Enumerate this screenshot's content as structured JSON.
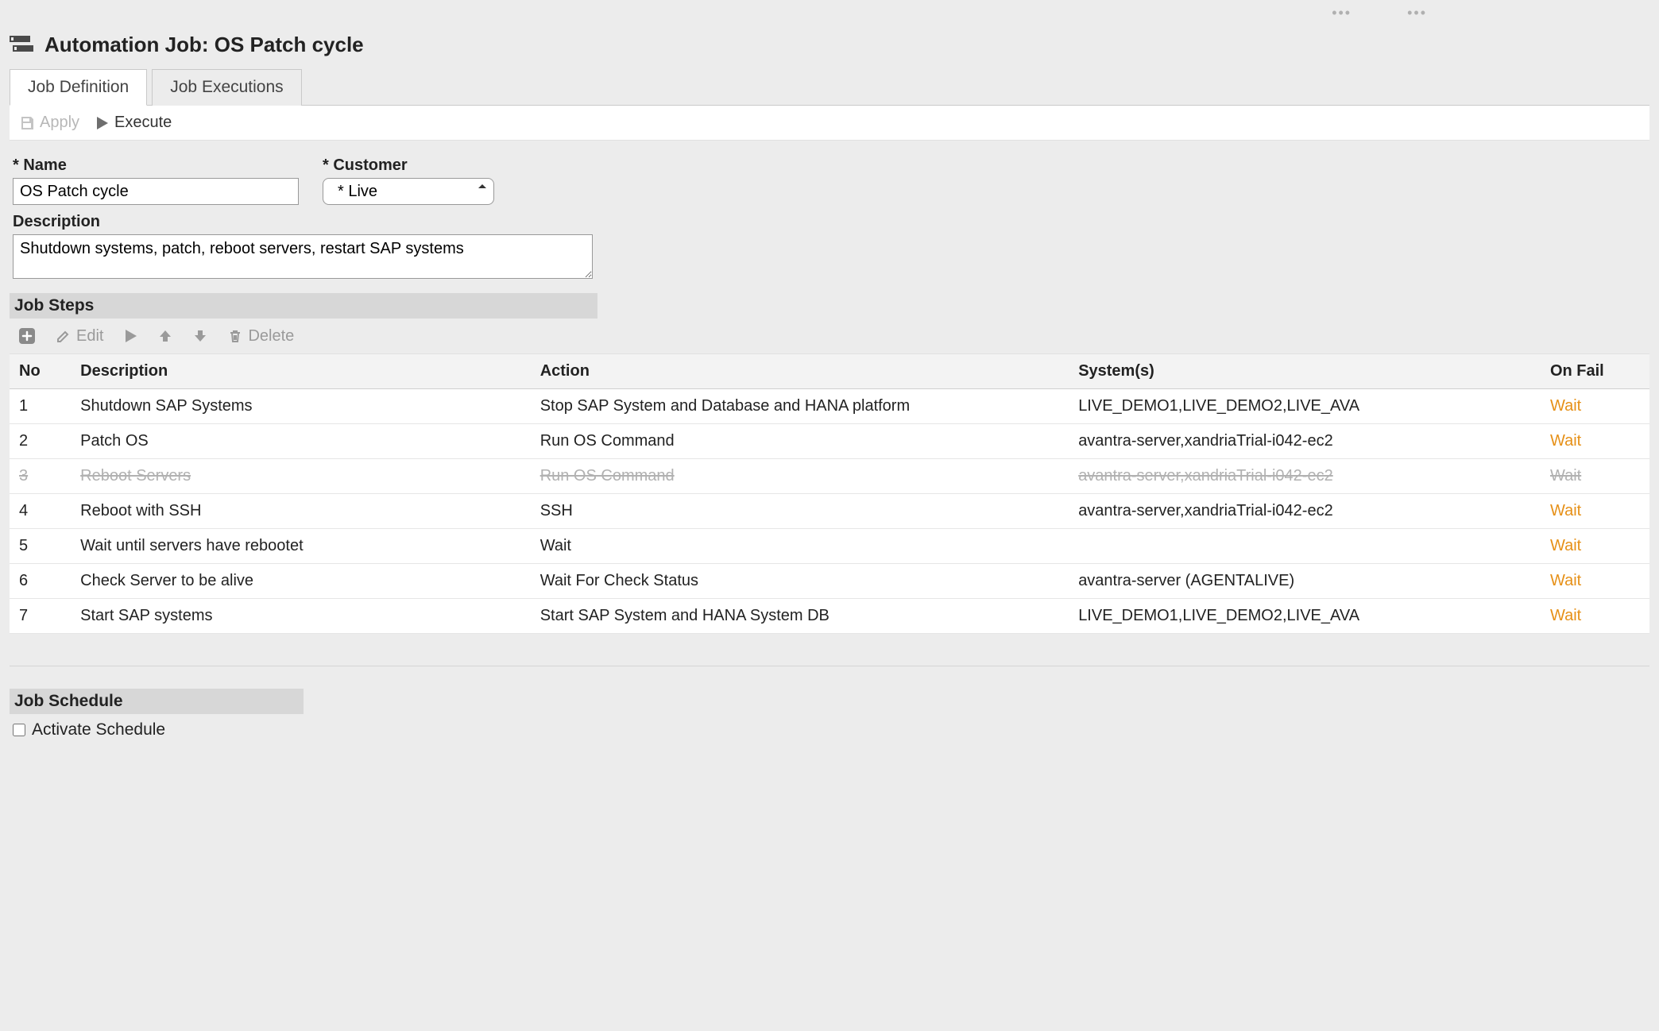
{
  "header": {
    "title": "Automation Job: OS Patch cycle"
  },
  "tabs": {
    "definition": "Job Definition",
    "executions": "Job Executions"
  },
  "toolbar": {
    "apply": "Apply",
    "execute": "Execute"
  },
  "form": {
    "name_label": "* Name",
    "name_value": "OS Patch cycle",
    "customer_label": "* Customer",
    "customer_value": "* Live",
    "description_label": "Description",
    "description_value": "Shutdown systems, patch, reboot servers, restart SAP systems"
  },
  "steps_section": {
    "title": "Job Steps",
    "toolbar": {
      "edit": "Edit",
      "delete": "Delete"
    },
    "columns": {
      "no": "No",
      "description": "Description",
      "action": "Action",
      "systems": "System(s)",
      "onfail": "On Fail"
    },
    "rows": [
      {
        "no": "1",
        "desc": "Shutdown SAP Systems",
        "action": "Stop SAP System and Database and HANA platform",
        "systems": "LIVE_DEMO1,LIVE_DEMO2,LIVE_AVA",
        "onfail": "Wait",
        "disabled": false
      },
      {
        "no": "2",
        "desc": "Patch OS",
        "action": "Run OS Command",
        "systems": "avantra-server,xandriaTrial-i042-ec2",
        "onfail": "Wait",
        "disabled": false
      },
      {
        "no": "3",
        "desc": "Reboot Servers",
        "action": "Run OS Command",
        "systems": "avantra-server,xandriaTrial-i042-ec2",
        "onfail": "Wait",
        "disabled": true
      },
      {
        "no": "4",
        "desc": "Reboot with SSH",
        "action": "SSH",
        "systems": "avantra-server,xandriaTrial-i042-ec2",
        "onfail": "Wait",
        "disabled": false
      },
      {
        "no": "5",
        "desc": "Wait until servers have rebootet",
        "action": "Wait",
        "systems": "",
        "onfail": "Wait",
        "disabled": false
      },
      {
        "no": "6",
        "desc": "Check Server to be alive",
        "action": "Wait For Check Status",
        "systems": "avantra-server (AGENTALIVE)",
        "onfail": "Wait",
        "disabled": false
      },
      {
        "no": "7",
        "desc": "Start SAP systems",
        "action": "Start SAP System and HANA System DB",
        "systems": "LIVE_DEMO1,LIVE_DEMO2,LIVE_AVA",
        "onfail": "Wait",
        "disabled": false
      }
    ]
  },
  "schedule": {
    "title": "Job Schedule",
    "activate_label": "Activate Schedule"
  }
}
